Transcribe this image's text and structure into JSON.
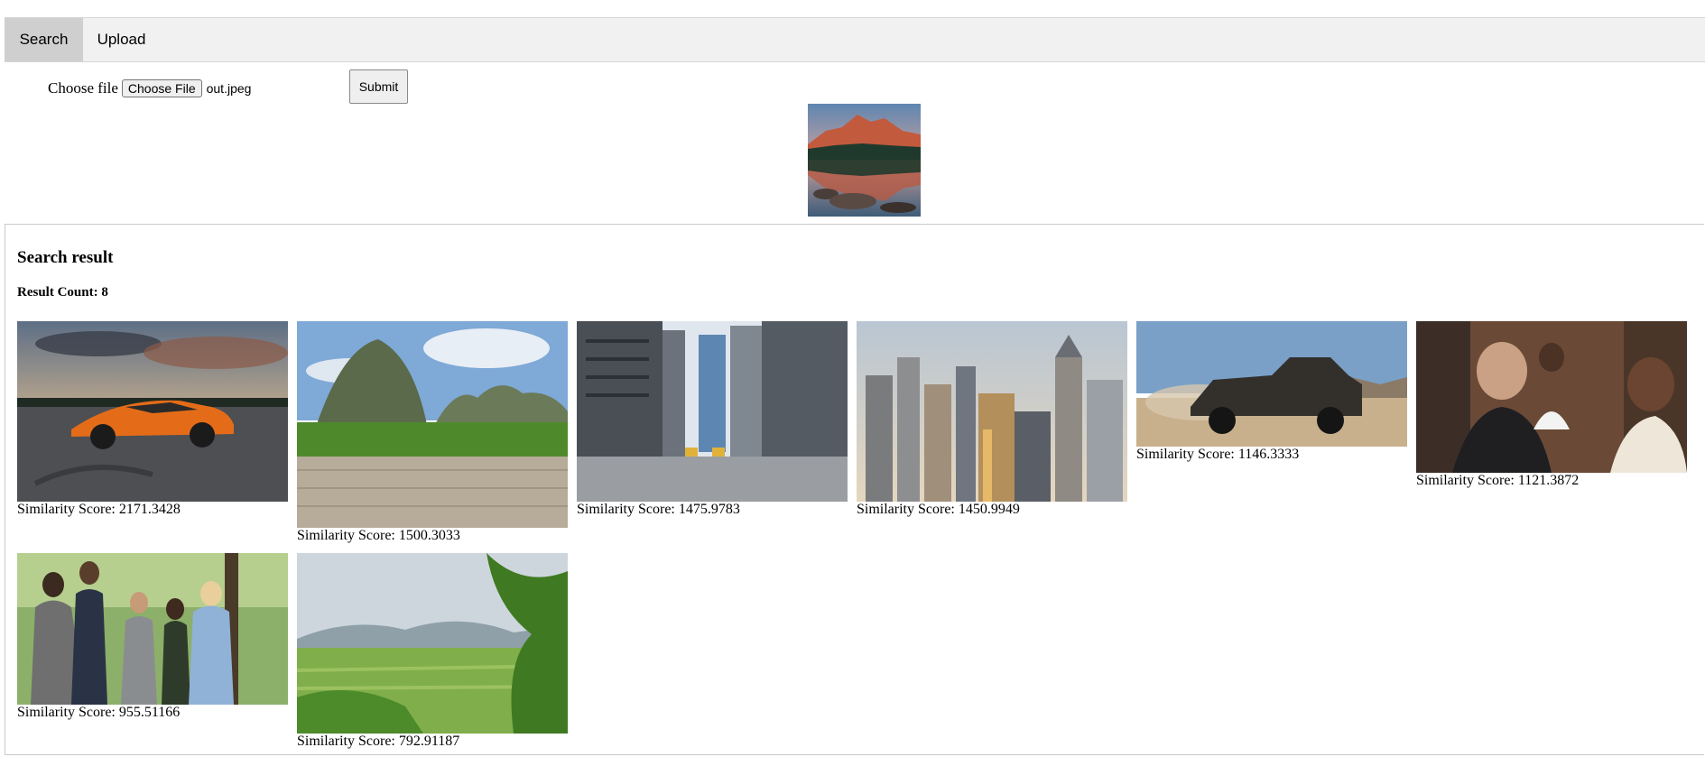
{
  "tabs": [
    {
      "label": "Search",
      "active": true
    },
    {
      "label": "Upload",
      "active": false
    }
  ],
  "form": {
    "choose_label": "Choose file",
    "file_button": "Choose File",
    "file_name": "out.jpeg",
    "submit": "Submit"
  },
  "query_image": {
    "subject": "mountain lake reflection at sunset"
  },
  "results": {
    "heading": "Search result",
    "count_label": "Result Count: 8",
    "items": [
      {
        "subject": "orange sports car",
        "score_text": "Similarity Score: 2171.3428"
      },
      {
        "subject": "green karst mountain",
        "score_text": "Similarity Score: 1500.3033"
      },
      {
        "subject": "city street between skyscrapers",
        "score_text": "Similarity Score: 1475.9783"
      },
      {
        "subject": "city skyline at sunset",
        "score_text": "Similarity Score: 1450.9949"
      },
      {
        "subject": "black pickup truck in desert",
        "score_text": "Similarity Score: 1146.3333"
      },
      {
        "subject": "man and woman at party",
        "score_text": "Similarity Score: 1121.3872"
      },
      {
        "subject": "group of students walking",
        "score_text": "Similarity Score: 955.51166"
      },
      {
        "subject": "green valley landscape",
        "score_text": "Similarity Score: 792.91187"
      }
    ]
  }
}
